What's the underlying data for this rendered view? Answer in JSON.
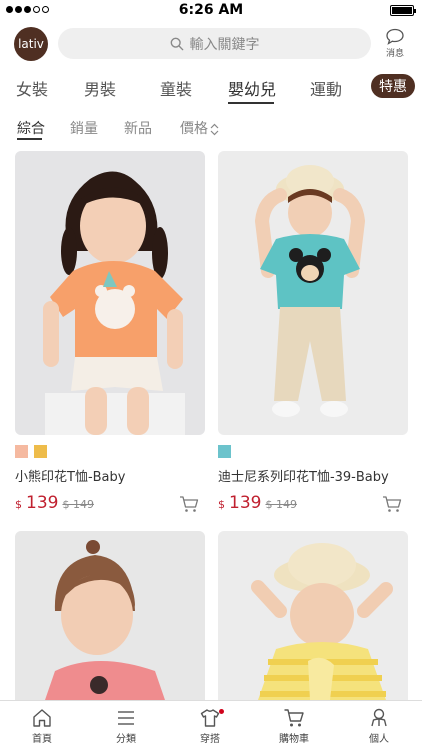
{
  "status_bar": {
    "time": "6:26 AM"
  },
  "header": {
    "logo_text": "lativ",
    "search_placeholder": "輸入關鍵字",
    "message_label": "消息"
  },
  "categories": [
    {
      "label": "女裝",
      "active": false
    },
    {
      "label": "男裝",
      "active": false
    },
    {
      "label": "童裝",
      "active": false
    },
    {
      "label": "嬰幼兒",
      "active": true
    },
    {
      "label": "運動",
      "active": false
    },
    {
      "label": "特惠",
      "active": false,
      "highlight": true
    }
  ],
  "sort_options": [
    {
      "label": "綜合",
      "active": true
    },
    {
      "label": "銷量",
      "active": false
    },
    {
      "label": "新品",
      "active": false
    },
    {
      "label": "價格",
      "active": false,
      "icon": "sort-arrows-icon"
    }
  ],
  "products": [
    {
      "name": "小熊印花T恤-Baby",
      "currency": "$",
      "price": "139",
      "original_price": "$ 149",
      "swatches": [
        "#f5b9a0",
        "#eebc4a"
      ],
      "image": "toddler girl in orange bear-print t-shirt"
    },
    {
      "name": "迪士尼系列印花T恤-39-Baby",
      "currency": "$",
      "price": "139",
      "original_price": "$ 149",
      "swatches": [
        "#6cc3cc"
      ],
      "image": "toddler in teal Mickey t-shirt and straw hat"
    },
    {
      "name": "",
      "image": "toddler girl in pink t-shirt"
    },
    {
      "name": "",
      "image": "toddler in yellow striped t-shirt and straw hat"
    }
  ],
  "bottom_nav": [
    {
      "label": "首頁",
      "icon": "home-icon"
    },
    {
      "label": "分類",
      "icon": "menu-icon"
    },
    {
      "label": "穿搭",
      "icon": "shirt-icon",
      "badge": true
    },
    {
      "label": "購物車",
      "icon": "cart-icon"
    },
    {
      "label": "個人",
      "icon": "person-icon"
    }
  ],
  "colors": {
    "brand": "#4f2f22",
    "price": "#c0202f",
    "search_bg": "#efefef"
  }
}
